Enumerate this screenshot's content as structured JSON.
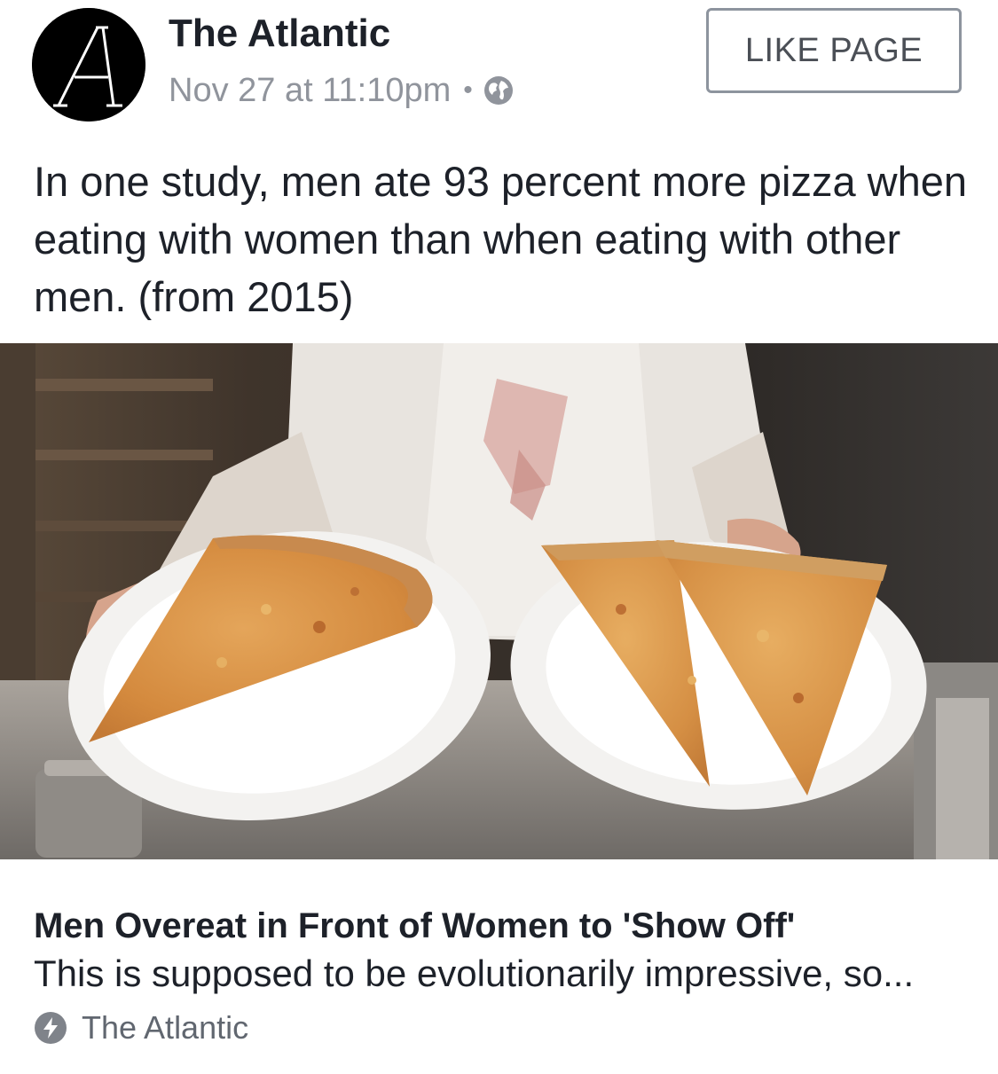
{
  "header": {
    "page_name": "The Atlantic",
    "timestamp": "Nov 27 at 11:10pm",
    "separator": "•",
    "privacy_icon": "globe-icon",
    "like_button_label": "LIKE PAGE",
    "avatar_letter": "A"
  },
  "post": {
    "text": "In one study, men ate 93 percent more pizza when eating with women than when eating with other men. (from 2015)"
  },
  "photo": {
    "description_icon": "pizza-photo"
  },
  "link_preview": {
    "title": "Men Overeat in Front of Women to 'Show Off'",
    "description": "This is supposed to be evolutionarily impressive, so...",
    "source": "The Atlantic",
    "source_icon": "instant-article-bolt-icon"
  },
  "colors": {
    "text_primary": "#1d2129",
    "text_secondary": "#90949c",
    "button_border": "#8d949e",
    "button_text": "#4b4f56"
  }
}
